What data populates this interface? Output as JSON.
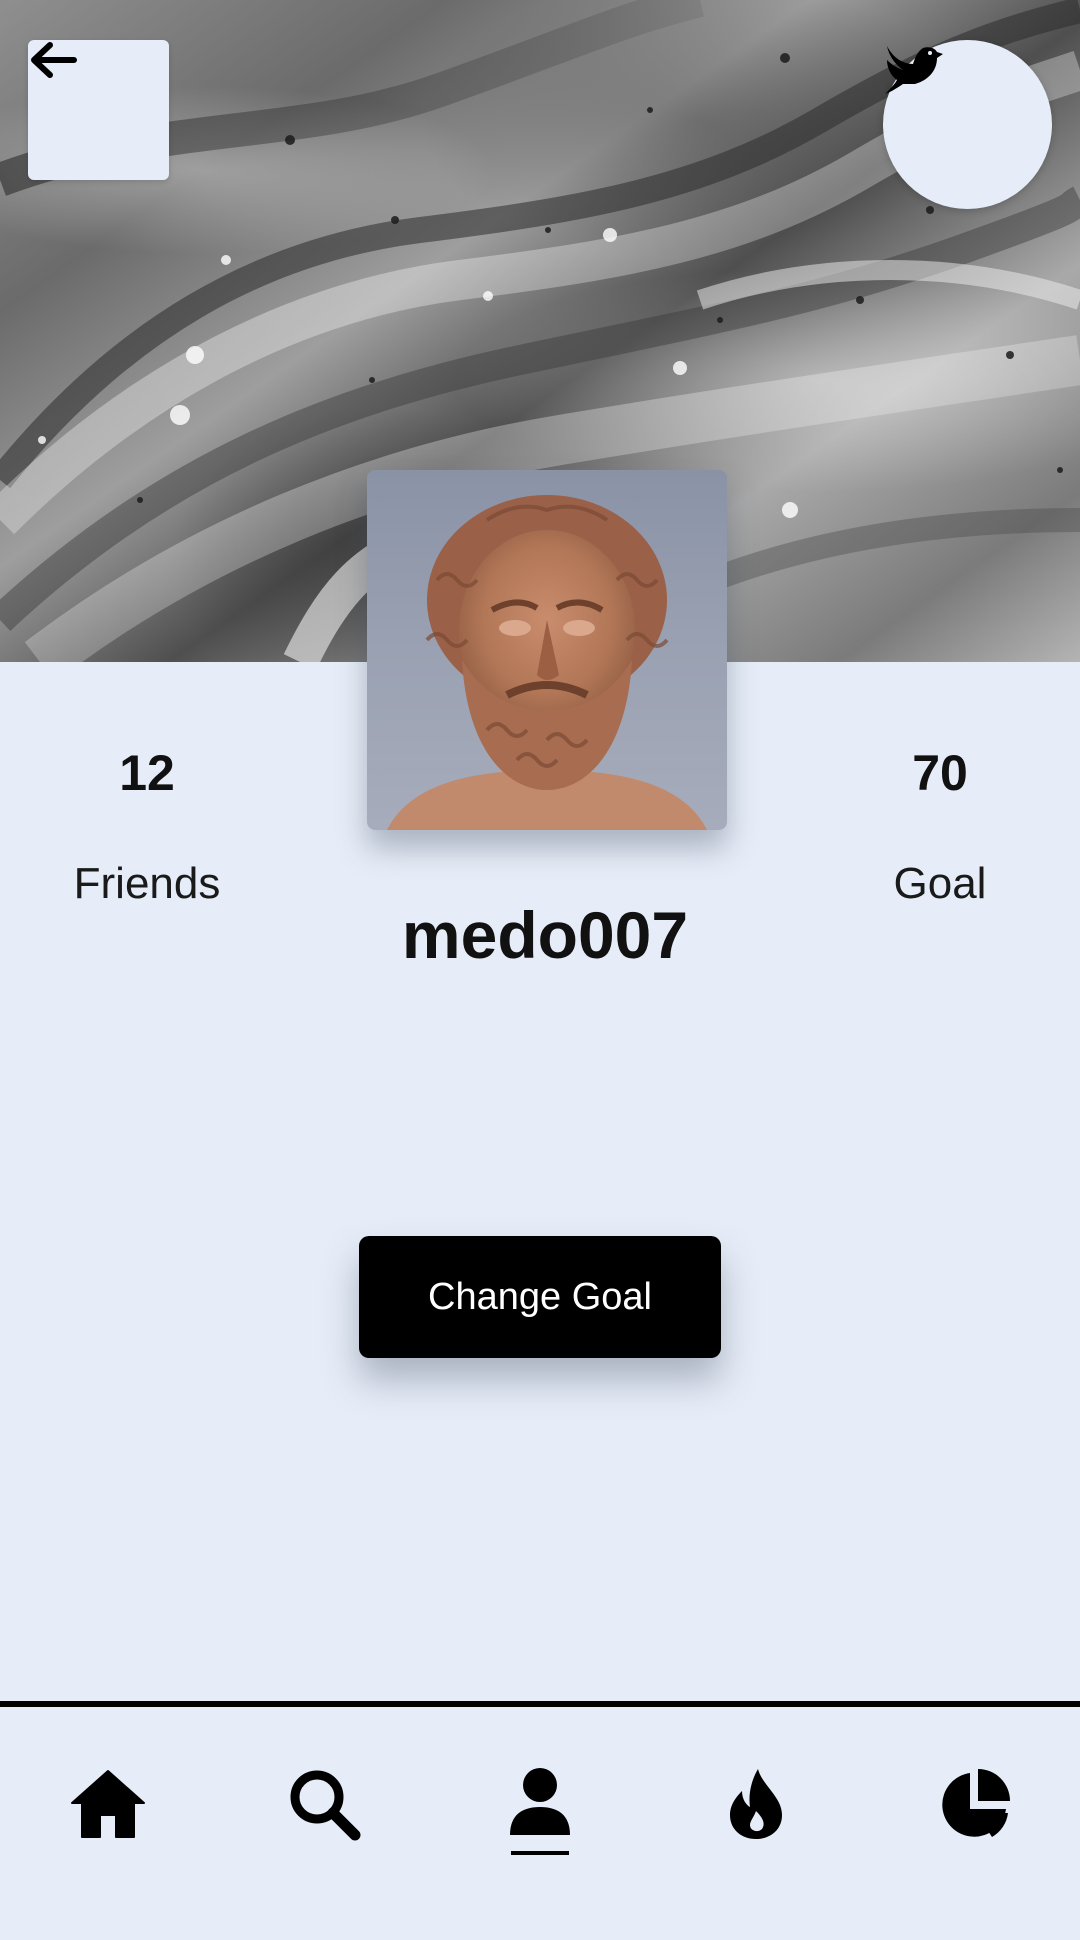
{
  "header": {
    "back_icon": "arrow-left-icon",
    "bird_icon": "dove-icon"
  },
  "profile": {
    "username": "medo007",
    "avatar": "bust-portrait"
  },
  "stats": {
    "friends": {
      "value": "12",
      "label": "Friends"
    },
    "goal": {
      "value": "70",
      "label": "Goal"
    }
  },
  "actions": {
    "change_goal_label": "Change Goal"
  },
  "nav": {
    "items": [
      {
        "icon": "home-icon",
        "active": false
      },
      {
        "icon": "search-icon",
        "active": false
      },
      {
        "icon": "user-icon",
        "active": true
      },
      {
        "icon": "fire-icon",
        "active": false
      },
      {
        "icon": "pie-chart-icon",
        "active": false
      }
    ]
  },
  "colors": {
    "background": "#e6edf8",
    "button": "#000000",
    "button_text": "#ffffff"
  }
}
